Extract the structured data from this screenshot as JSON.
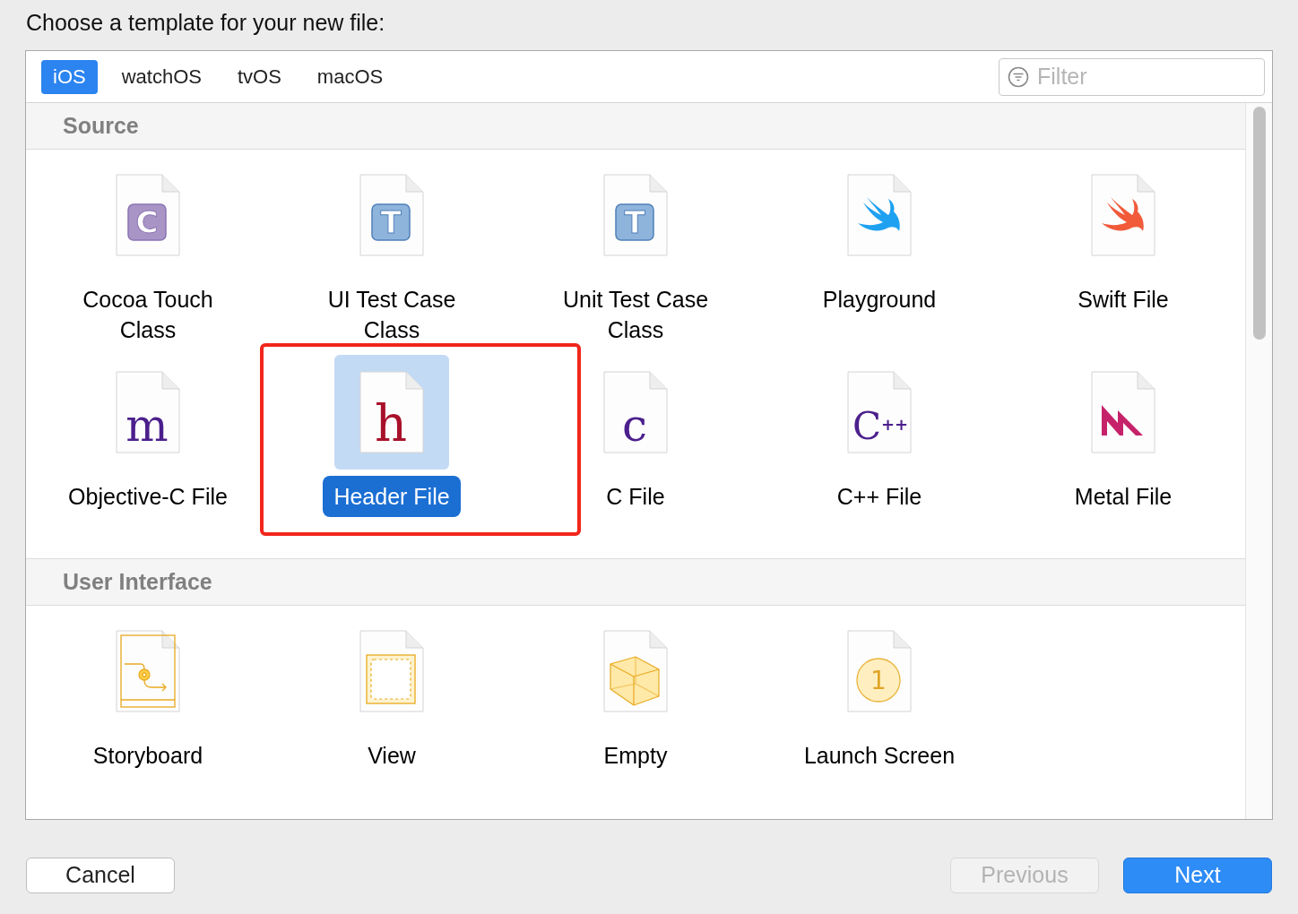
{
  "prompt": "Choose a template for your new file:",
  "tabs": [
    {
      "label": "iOS",
      "selected": true
    },
    {
      "label": "watchOS",
      "selected": false
    },
    {
      "label": "tvOS",
      "selected": false
    },
    {
      "label": "macOS",
      "selected": false
    }
  ],
  "filter": {
    "placeholder": "Filter"
  },
  "sections": [
    {
      "title": "Source",
      "items": [
        {
          "label": "Cocoa Touch Class",
          "kind": "class",
          "glyph": "C",
          "selected": false,
          "highlighted": false
        },
        {
          "label": "UI Test Case Class",
          "kind": "test",
          "glyph": "T",
          "selected": false,
          "highlighted": false
        },
        {
          "label": "Unit Test Case Class",
          "kind": "test",
          "glyph": "T",
          "selected": false,
          "highlighted": false
        },
        {
          "label": "Playground",
          "kind": "playground",
          "selected": false,
          "highlighted": false
        },
        {
          "label": "Swift File",
          "kind": "swift",
          "selected": false,
          "highlighted": false
        },
        {
          "label": "Objective-C File",
          "kind": "source",
          "glyph": "m",
          "selected": false,
          "highlighted": false
        },
        {
          "label": "Header File",
          "kind": "header",
          "glyph": "h",
          "selected": true,
          "highlighted": true
        },
        {
          "label": "C File",
          "kind": "source",
          "glyph": "c",
          "selected": false,
          "highlighted": false
        },
        {
          "label": "C++ File",
          "kind": "cpp",
          "glyph": "C",
          "glyph2": "++",
          "selected": false,
          "highlighted": false
        },
        {
          "label": "Metal File",
          "kind": "metal",
          "selected": false,
          "highlighted": false
        }
      ]
    },
    {
      "title": "User Interface",
      "items": [
        {
          "label": "Storyboard",
          "kind": "storyboard",
          "selected": false,
          "highlighted": false
        },
        {
          "label": "View",
          "kind": "view",
          "selected": false,
          "highlighted": false
        },
        {
          "label": "Empty",
          "kind": "cube",
          "selected": false,
          "highlighted": false
        },
        {
          "label": "Launch Screen",
          "kind": "launch",
          "glyph": "1",
          "selected": false,
          "highlighted": false
        }
      ]
    }
  ],
  "buttons": [
    {
      "label": "Cancel",
      "kind": "normal",
      "disabled": false
    },
    {
      "label": "Previous",
      "kind": "normal",
      "disabled": true
    },
    {
      "label": "Next",
      "kind": "default",
      "disabled": false
    }
  ]
}
